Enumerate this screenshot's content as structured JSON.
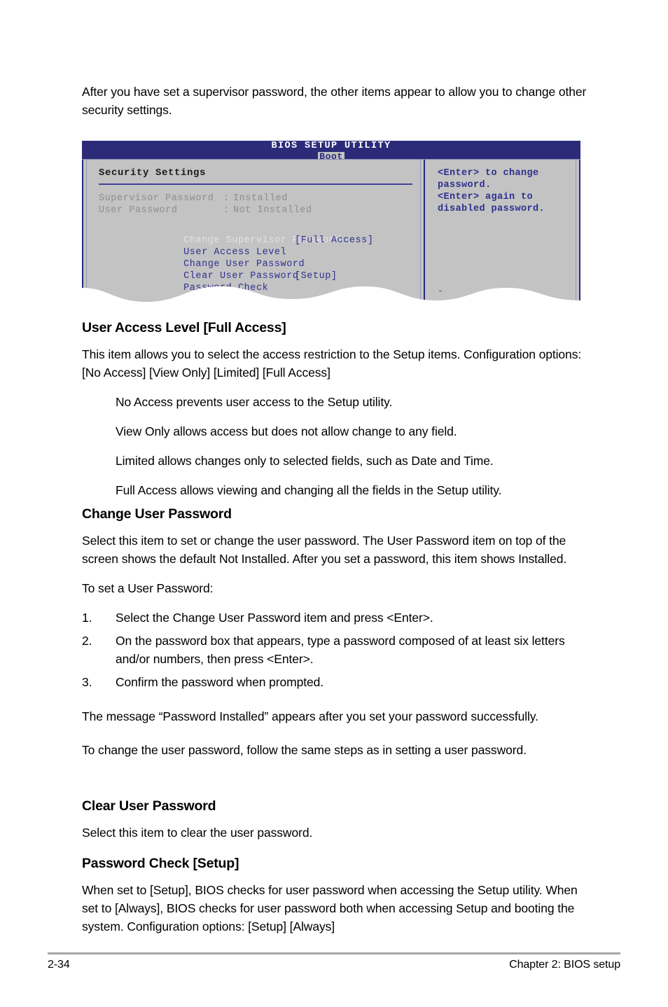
{
  "intro": {
    "paragraph": "After you have set a supervisor password, the other items appear to allow you to change other security settings."
  },
  "bios_figure": {
    "title": "BIOS SETUP UTILITY",
    "active_tab": "Boot",
    "section_title": "Security Settings",
    "status_rows": [
      {
        "label": "Supervisor Password",
        "separator": ":",
        "value": "Installed"
      },
      {
        "label": "User Password",
        "separator": ":",
        "value": "Not Installed"
      }
    ],
    "menu_rows": [
      {
        "label": "Change Supervisor Password",
        "value": "",
        "selected": true
      },
      {
        "label": "User Access Level",
        "value": "[Full Access]",
        "selected": false
      },
      {
        "label": "Change User Password",
        "value": "",
        "selected": false
      },
      {
        "label": "Clear User Password",
        "value": "",
        "selected": false
      },
      {
        "label": "Password Check",
        "value": "[Setup]",
        "selected": false
      }
    ],
    "help_text": "<Enter> to change password.\n<Enter> again to disabled password.",
    "help_dash": "-",
    "colors": {
      "title_bar": "#2b2b7a",
      "panel_bg": "#c3c3c3",
      "menu_text": "#2f2f8f",
      "status_text": "#8e8e93",
      "selected_row_text": "#e2e2ea"
    }
  },
  "sections": [
    {
      "heading": "User Access Level [Full Access]",
      "paragraph": "This item allows you to select the access restriction to the Setup items. Configuration options: [No Access] [View Only] [Limited] [Full Access]",
      "indented": [
        "No Access prevents user access to the Setup utility.",
        "View Only allows access but does not allow change to any field.",
        "Limited allows changes only to selected fields, such as Date and Time.",
        "Full Access allows viewing and changing all the fields in the Setup utility."
      ]
    },
    {
      "heading": "Change User Password",
      "paragraph": "Select this item to set or change the user password. The User Password item on top of the screen shows the default Not Installed. After you set a password, this item shows Installed.",
      "lead_in": "To set a User Password:",
      "steps": [
        {
          "num": "1.",
          "text": "Select the Change User Password item and press <Enter>."
        },
        {
          "num": "2.",
          "text": "On the password box that appears, type a password composed of at least six letters and/or numbers, then press <Enter>."
        },
        {
          "num": "3.",
          "text": "Confirm the password when prompted."
        }
      ],
      "after_steps": [
        "The message “Password Installed” appears after you set your password successfully.",
        "To change the user password, follow the same steps as in setting a user password."
      ]
    },
    {
      "heading": "Clear User Password",
      "paragraph": "Select this item to clear the user password."
    },
    {
      "heading": "Password Check [Setup]",
      "paragraph": "When set to [Setup], BIOS checks for user password when accessing the Setup utility. When set to [Always], BIOS checks for user password both when accessing Setup and booting the system. Configuration options: [Setup] [Always]"
    }
  ],
  "footer": {
    "page_number": "2-34",
    "chapter": "Chapter 2: BIOS setup"
  }
}
